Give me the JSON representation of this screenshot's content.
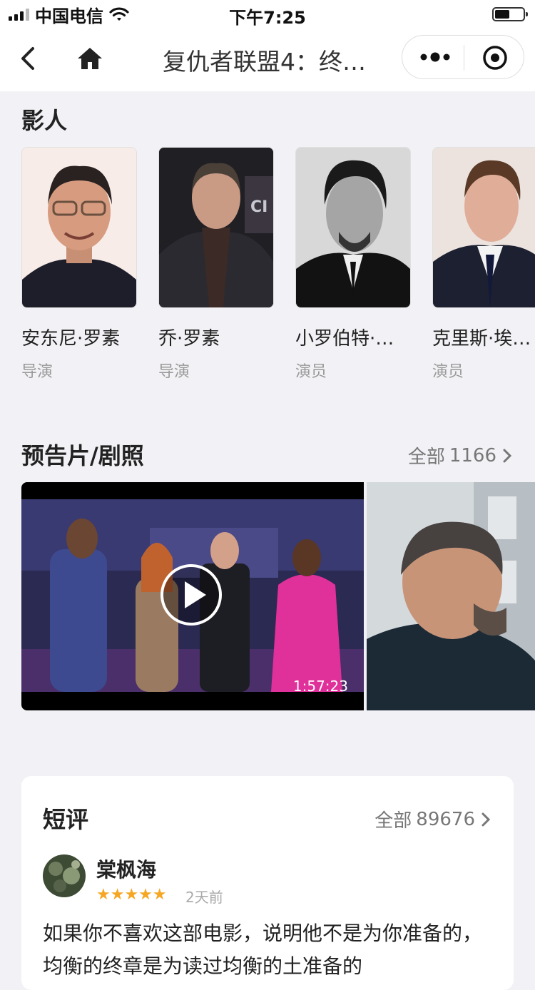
{
  "status_bar": {
    "carrier": "中国电信",
    "time": "下午7:25"
  },
  "nav": {
    "title": "复仇者联盟4：终…"
  },
  "cast": {
    "title": "影人",
    "members": [
      {
        "name": "安东尼·罗素",
        "role": "导演"
      },
      {
        "name": "乔·罗素",
        "role": "导演"
      },
      {
        "name": "小罗伯特·…",
        "role": "演员"
      },
      {
        "name": "克里斯·埃…",
        "role": "演员"
      }
    ]
  },
  "trailers": {
    "title": "预告片/剧照",
    "all_label": "全部",
    "count": "1166",
    "video_duration": "1:57:23"
  },
  "reviews": {
    "title": "短评",
    "all_label": "全部",
    "count": "89676",
    "items": [
      {
        "user": "棠枫海",
        "stars": "★★★★★",
        "time": "2天前",
        "text": "如果你不喜欢这部电影，说明他不是为你准备的，均衡的终章是为读过均衡的土准备的"
      }
    ]
  },
  "colors": {
    "accent_star": "#f5a623",
    "background": "#f2f2f6"
  }
}
